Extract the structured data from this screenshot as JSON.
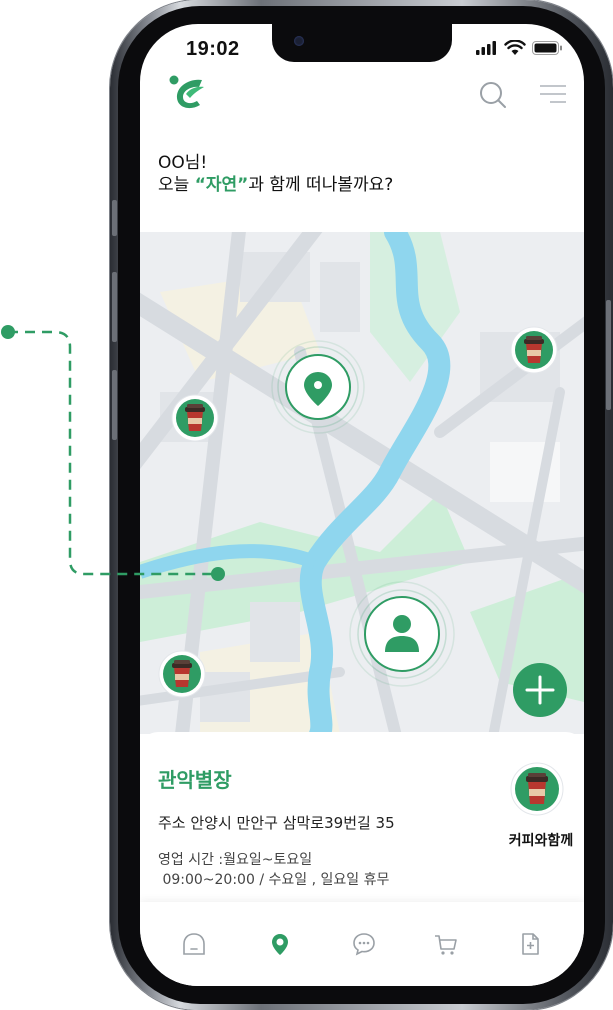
{
  "status_bar": {
    "time": "19:02"
  },
  "greeting": {
    "line1": "OO님!",
    "line2_prefix": "오늘 ",
    "line2_accent": "“자연”",
    "line2_suffix": "과 함께 떠나볼까요?"
  },
  "place_card": {
    "name": "관악별장",
    "address": "주소  안양시 만안구 삼막로39번길 35",
    "hours_label": "영업 시간 :월요일~토요일",
    "hours_detail": " 09:00~20:00 / 수요일 , 일요일 휴무",
    "category_label": "커피와함께",
    "category_icon": "coffee-cup-icon"
  },
  "map": {
    "markers": [
      "coffee-cup-icon",
      "coffee-cup-icon",
      "coffee-cup-icon",
      "location-pin-icon",
      "user-location-icon"
    ],
    "fab_icon": "plus-icon"
  },
  "tabs": [
    {
      "name": "home",
      "icon": "home-icon"
    },
    {
      "name": "map",
      "icon": "location-pin-icon",
      "active": true
    },
    {
      "name": "chat",
      "icon": "chat-icon"
    },
    {
      "name": "cart",
      "icon": "cart-icon"
    },
    {
      "name": "document",
      "icon": "document-icon"
    }
  ],
  "colors": {
    "accent": "#2f9c64",
    "water": "#8fd6ee",
    "park": "#cdeed8",
    "road": "#d7dbe0",
    "block": "#eceef1"
  }
}
